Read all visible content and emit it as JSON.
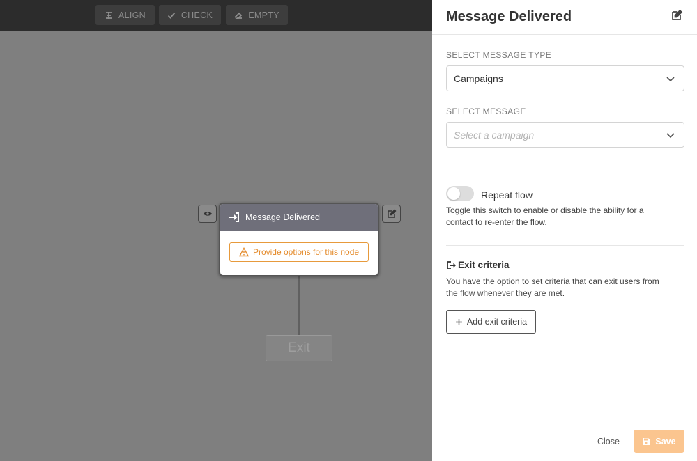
{
  "toolbar": {
    "align_label": "ALIGN",
    "check_label": "CHECK",
    "empty_label": "EMPTY"
  },
  "node": {
    "title": "Message Delivered",
    "warning": "Provide options for this node"
  },
  "exit_node": {
    "label": "Exit"
  },
  "panel": {
    "title": "Message Delivered",
    "message_type": {
      "label": "SELECT MESSAGE TYPE",
      "value": "Campaigns"
    },
    "message": {
      "label": "SELECT MESSAGE",
      "placeholder": "Select a campaign"
    },
    "repeat": {
      "label": "Repeat flow",
      "enabled": false,
      "description": "Toggle this switch to enable or disable the ability for a contact to re-enter the flow."
    },
    "exit_criteria": {
      "title": "Exit criteria",
      "description": "You have the option to set criteria that can exit users from the flow whenever they are met.",
      "add_label": "Add exit criteria"
    },
    "footer": {
      "close_label": "Close",
      "save_label": "Save"
    }
  },
  "colors": {
    "accent": "#fbc58f",
    "warning": "#e48a2a",
    "node_header": "#6f6f7a"
  }
}
